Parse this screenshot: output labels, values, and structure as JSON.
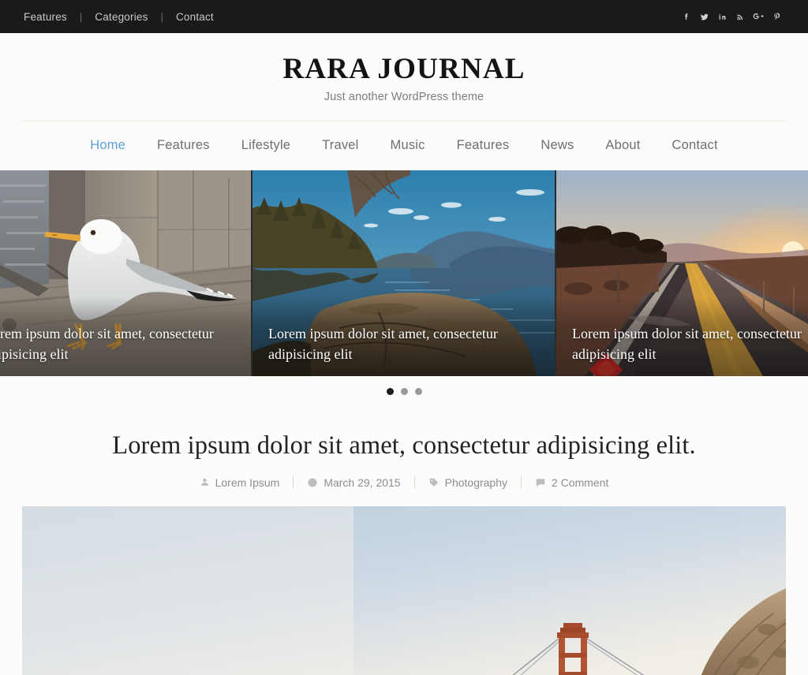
{
  "topbar": {
    "links": [
      {
        "label": "Features"
      },
      {
        "label": "Categories"
      },
      {
        "label": "Contact"
      }
    ],
    "separator": "|",
    "social": [
      {
        "name": "facebook-icon",
        "label": "Facebook"
      },
      {
        "name": "twitter-icon",
        "label": "Twitter"
      },
      {
        "name": "linkedin-icon",
        "label": "LinkedIn"
      },
      {
        "name": "rss-icon",
        "label": "RSS"
      },
      {
        "name": "googleplus-icon",
        "label": "Google Plus"
      },
      {
        "name": "pinterest-icon",
        "label": "Pinterest"
      }
    ],
    "background_color": "#1a1a1a",
    "link_color": "#c9c9c9"
  },
  "header": {
    "site_title": "RARA JOURNAL",
    "tagline": "Just another WordPress theme"
  },
  "mainnav": {
    "active_color": "#5a9fd4",
    "items": [
      {
        "label": "Home",
        "active": true
      },
      {
        "label": "Features",
        "active": false
      },
      {
        "label": "Lifestyle",
        "active": false
      },
      {
        "label": "Travel",
        "active": false
      },
      {
        "label": "Music",
        "active": false
      },
      {
        "label": "Features",
        "active": false
      },
      {
        "label": "News",
        "active": false
      },
      {
        "label": "About",
        "active": false
      },
      {
        "label": "Contact",
        "active": false
      }
    ]
  },
  "slider": {
    "slides": [
      {
        "caption": "Lorem ipsum dolor sit amet, consectetur adipisicing elit",
        "image_alt": "seagull standing on a concrete dock beside water"
      },
      {
        "caption": "Lorem ipsum dolor sit amet, consectetur adipisicing elit",
        "image_alt": "mountain lake with forest reflection and rocky foreground"
      },
      {
        "caption": "Lorem ipsum dolor sit amet, consectetur adipisicing elit",
        "image_alt": "desert highway at sunset with red diamond road sign"
      }
    ],
    "dots": [
      {
        "active": true
      },
      {
        "active": false
      },
      {
        "active": false
      }
    ]
  },
  "post": {
    "title": "Lorem ipsum dolor sit amet, consectetur adipisicing elit.",
    "meta": {
      "author": "Lorem Ipsum",
      "date": "March 29, 2015",
      "category": "Photography",
      "comments": "2 Comment"
    },
    "featured_image_alt": "Golden Gate Bridge tower beside a coastal hillside under pale sky"
  }
}
